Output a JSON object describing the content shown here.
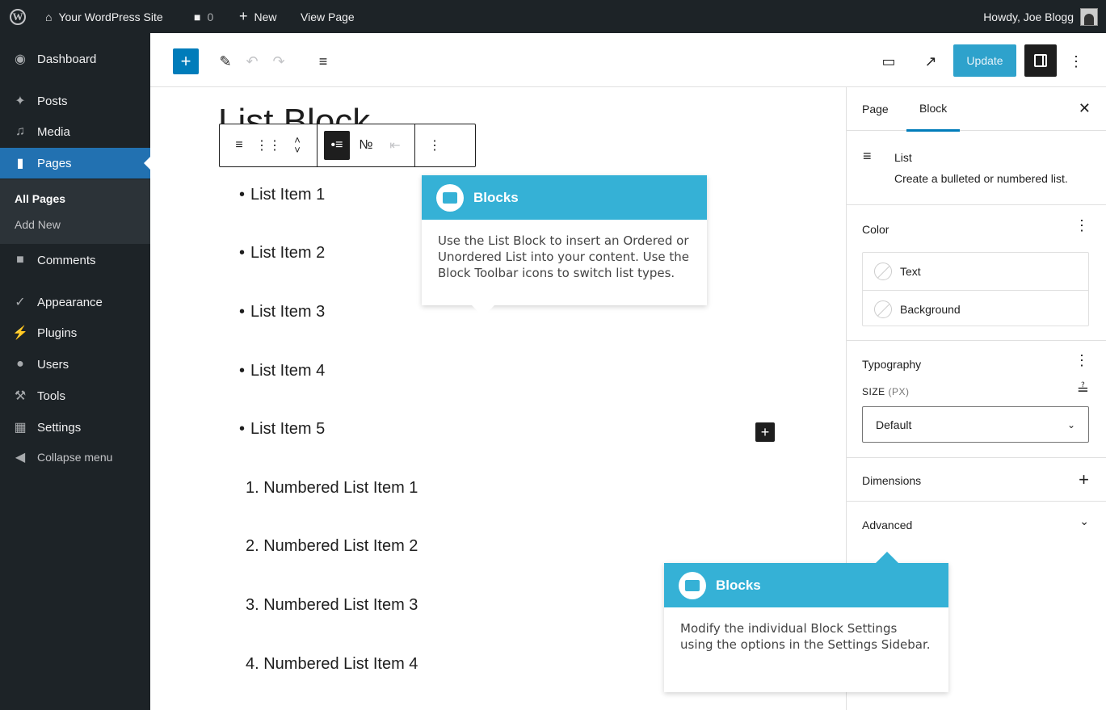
{
  "adminbar": {
    "site_name": "Your WordPress Site",
    "comments_count": "0",
    "new_label": "New",
    "view_page_label": "View Page",
    "howdy": "Howdy, Joe Blogg"
  },
  "menu": {
    "dashboard": "Dashboard",
    "posts": "Posts",
    "media": "Media",
    "pages": "Pages",
    "all_pages": "All Pages",
    "add_new": "Add New",
    "comments": "Comments",
    "appearance": "Appearance",
    "plugins": "Plugins",
    "users": "Users",
    "tools": "Tools",
    "settings": "Settings",
    "collapse": "Collapse menu"
  },
  "header": {
    "update_label": "Update",
    "accent_color": "#007cba"
  },
  "editor": {
    "title": "List Block",
    "bullet_items": [
      "List Item 1",
      "List Item 2",
      "List Item 3",
      "List Item 4",
      "List Item 5"
    ],
    "numbered_items": [
      "1. Numbered List Item 1",
      "2. Numbered List Item 2",
      "3. Numbered List Item 3",
      "4. Numbered List Item 4"
    ]
  },
  "sidebar": {
    "tab_page": "Page",
    "tab_block": "Block",
    "block_name": "List",
    "block_description": "Create a bulleted or numbered list.",
    "color_title": "Color",
    "color_text": "Text",
    "color_background": "Background",
    "typography_title": "Typography",
    "size_label": "SIZE",
    "size_unit": "(PX)",
    "size_value": "Default",
    "dimensions_title": "Dimensions",
    "advanced_title": "Advanced"
  },
  "tours": [
    {
      "title": "Blocks",
      "body": "Use the List Block to insert an Ordered or Unordered List into your content. Use the Block Toolbar icons to switch list types."
    },
    {
      "title": "Blocks",
      "body": "Modify the individual Block Settings using the options in the Settings Sidebar."
    }
  ],
  "tour_color": "#35b1d6"
}
